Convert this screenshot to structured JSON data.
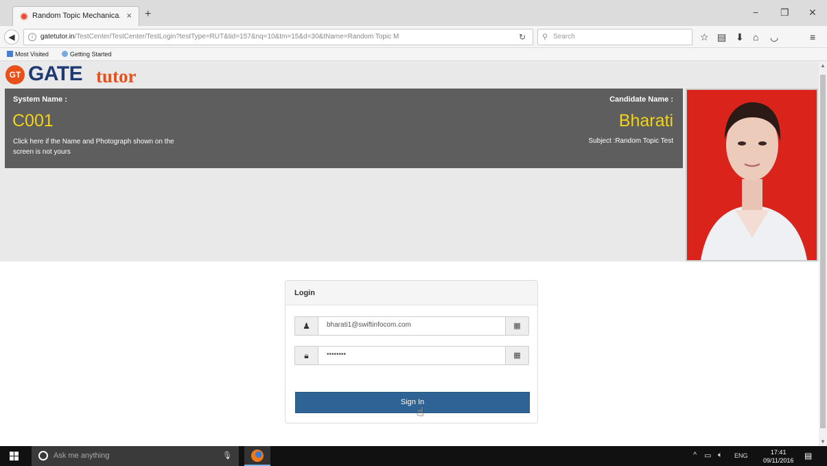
{
  "browser": {
    "tab_title": "Random Topic Mechanica...",
    "tab_close": "×",
    "new_tab": "+",
    "window_controls": {
      "minimize": "−",
      "restore": "❐",
      "close": "✕"
    },
    "url_host": "gatetutor.in",
    "url_path": "/TestCenter/TestCenter/TestLogin?testType=RUT&tid=157&nq=10&tm=15&d=30&tName=Random Topic M",
    "search_placeholder": "Search",
    "bookmarks": [
      "Most Visited",
      "Getting Started"
    ]
  },
  "header": {
    "logo_badge": "GT",
    "logo_gate": "GATE",
    "logo_tutor": "tutor"
  },
  "info_panel": {
    "system_label": "System Name :",
    "system_value": "C001",
    "notice": "Click here if the Name and Photograph shown on the screen is not yours",
    "candidate_label": "Candidate Name :",
    "candidate_value": "Bharati",
    "subject": "Subject :Random Topic Test"
  },
  "login": {
    "title": "Login",
    "username_value": "bharati1@swiftinfocom.com",
    "password_value": "••••••••",
    "signin_label": "Sign In"
  },
  "taskbar": {
    "search_placeholder": "Ask me anything",
    "language": "ENG",
    "time": "17:41",
    "date": "09/11/2016"
  },
  "colors": {
    "accent_yellow": "#f2d21b",
    "panel_gray": "#5e5e5e",
    "button_blue": "#2f6396",
    "logo_orange": "#e8501a",
    "logo_navy": "#1f3a73"
  }
}
